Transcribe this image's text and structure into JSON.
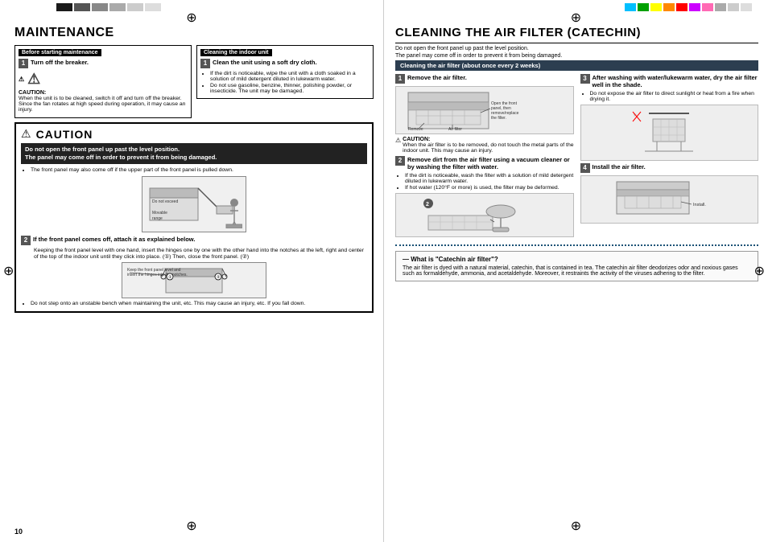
{
  "page": {
    "number": "10",
    "left": {
      "title": "MAINTENANCE",
      "before_starting": {
        "header": "Before starting maintenance",
        "step1_label": "1",
        "step1_text": "Turn off the breaker.",
        "caution_label": "CAUTION:",
        "caution_text": "When the unit is to be cleaned, switch it off and turn off the breaker. Since the fan rotates at high speed during operation, it may cause an injury."
      },
      "cleaning_indoor": {
        "header": "Cleaning the indoor unit",
        "step1_label": "1",
        "step1_text": "Clean the unit using a soft dry cloth.",
        "bullets": [
          "If the dirt is noticeable, wipe the unit with a cloth soaked in a solution of mild detergent diluted in lukewarm water.",
          "Do not use gasoline, benzine, thinner, polishing powder, or insecticide. The unit may be damaged."
        ]
      },
      "caution_box": {
        "title": "CAUTION",
        "bold_line1": "Do not open the front panel up past the level position.",
        "bold_line2": "The panel may come off in order to prevent it from being damaged.",
        "bullet": "The front panel may also come off if the upper part of the front panel is pulled down.",
        "diagram_labels": [
          "Do not exceed",
          "Movable range"
        ],
        "step2_label": "2",
        "step2_text": "If the front panel comes off, attach it as explained below.",
        "step2_detail": "Keeping the front panel level with one hand, insert the hinges one by one with the other hand into the notches at the left, right and center of the top of the indoor unit until they click into place. (①) Then, close the front panel. (②)",
        "diagram2_labels": [
          "Keep the front panel level and insert the hinges into the notches."
        ],
        "bullet2": "Do not step onto an unstable bench when maintaining the unit, etc. This may cause an injury, etc. If you fall down."
      }
    },
    "right": {
      "title": "CLEANING THE AIR FILTER (CATECHIN)",
      "notice1": "Do not open the front panel up past the level position.",
      "notice2": "The panel may come off in order to prevent it from being damaged.",
      "filter_section_header": "Cleaning the air filter (about once every 2 weeks)",
      "steps": {
        "step1_num": "1",
        "step1_text": "Remove the air filter.",
        "step1_diagram_labels": [
          "Open the front panel, then remove/replace the filter.",
          "Remove",
          "Air filter"
        ],
        "step1_caution_label": "CAUTION:",
        "step1_caution": "When the air filter is to be removed, do not touch the metal parts of the indoor unit. This may cause an injury.",
        "step2_num": "2",
        "step2_text": "Remove dirt from the air filter using a vacuum cleaner or by washing the filter with water.",
        "step2_bullets": [
          "If the dirt is noticeable, wash the filter with a solution of mild detergent diluted in lukewarm water.",
          "If hot water (120°F or more) is used, the filter may be deformed."
        ],
        "step3_num": "3",
        "step3_text": "After washing with water/lukewarm water, dry the air filter well in the shade.",
        "step3_bullets": [
          "Do not expose the air filter to direct sunlight or heat from a fire when drying it."
        ],
        "step4_num": "4",
        "step4_text": "Install the air filter.",
        "step4_diagram_label": "Install."
      },
      "catechin": {
        "title": "— What is \"Catechin air filter\"?",
        "body": "The air filter is dyed with a natural material, catechin, that is contained in tea. The catechin air filter deodorizes odor and noxious gases such as formaldehyde, ammonia, and acetaldehyde. Moreover, it restraints the activity of the viruses adhering to the filter."
      }
    }
  },
  "colors": {
    "blocks_left": [
      "#1a1a1a",
      "#555",
      "#888",
      "#aaa",
      "#ccc",
      "#ddd"
    ],
    "blocks_right": [
      "#00bfff",
      "#00a000",
      "#ff0",
      "#f80",
      "#f00",
      "#c0f",
      "#ff69b4",
      "#aaa",
      "#ccc",
      "#ddd"
    ]
  }
}
